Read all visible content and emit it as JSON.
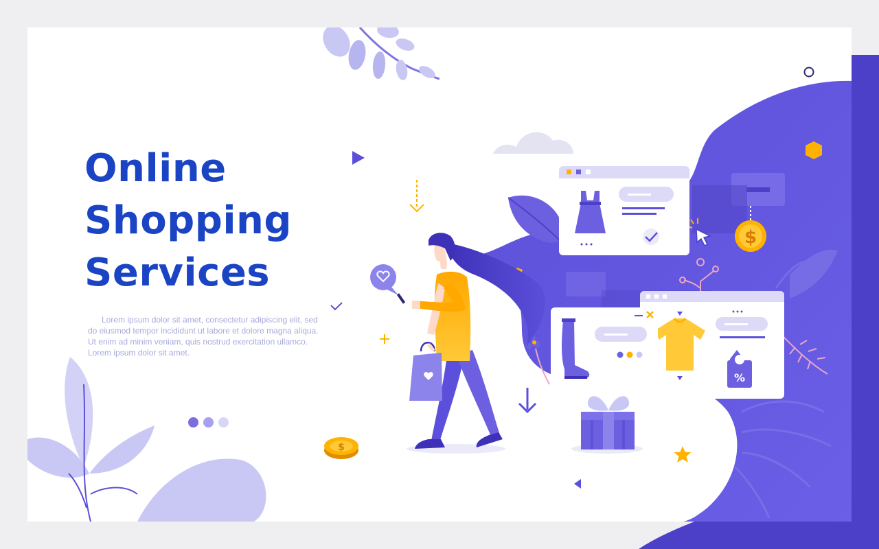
{
  "hero": {
    "title_lines": [
      "Online",
      "Shopping",
      "Services"
    ],
    "body": "Lorem ipsum dolor sit amet, consectetur adipiscing elit, sed do eiusmod tempor incididunt ut labore et dolore magna aliqua. Ut enim ad minim veniam, quis nostrud exercitation ullamco. Lorem ipsum dolor sit amet."
  },
  "illustration": {
    "price_tag_symbol": "%",
    "coin_symbol": "$"
  },
  "colors": {
    "title": "#1a44c4",
    "accent_purple": "#5b4fdc",
    "light_purple": "#c9c8f4",
    "yellow": "#ffb300",
    "background": "#efeff1"
  },
  "icons": [
    "heart-icon",
    "dollar-coin-icon",
    "gift-icon",
    "shopping-bag-icon",
    "dress-icon",
    "boot-icon",
    "tshirt-icon",
    "price-tag-icon",
    "cursor-icon",
    "checkmark-icon",
    "star-icon",
    "down-arrow-icon",
    "close-icon"
  ]
}
